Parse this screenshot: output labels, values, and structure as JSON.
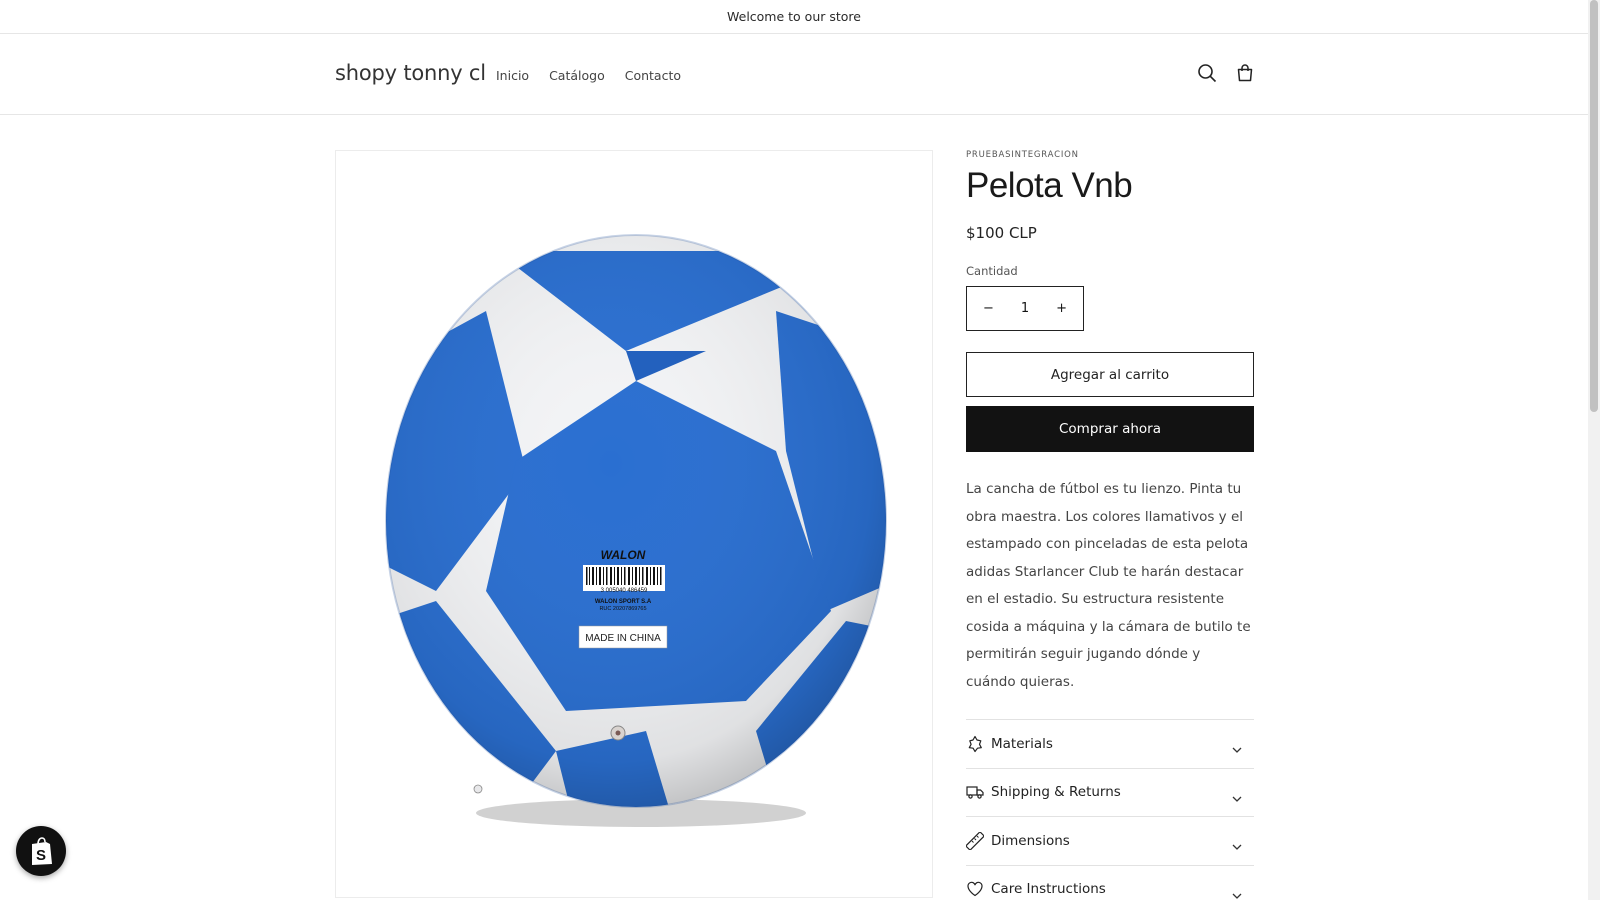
{
  "announcement": {
    "text": "Welcome to our store"
  },
  "header": {
    "logo": "shopy tonny cl",
    "nav": [
      "Inicio",
      "Catálogo",
      "Contacto"
    ],
    "icons": [
      "search-icon",
      "cart-icon"
    ]
  },
  "product": {
    "vendor": "PRUEBASINTEGRACION",
    "title": "Pelota Vnb",
    "price": "$100 CLP",
    "quantity_label": "Cantidad",
    "quantity_value": "1",
    "qty_minus": "−",
    "qty_plus": "+",
    "add_to_cart": "Agregar al carrito",
    "buy_now": "Comprar ahora",
    "description": "La cancha de fútbol es tu lienzo. Pinta tu obra maestra. Los colores llamativos y el estampado con pinceladas de esta pelota adidas Starlancer Club te harán destacar en el estadio. Su estructura resistente cosida a máquina y la cámara de butilo te permitirán seguir jugando dónde y cuándo quieras.",
    "image_labels": {
      "brand": "WALON",
      "barcode_number": "3 005040 486459",
      "company": "WALON SPORT S.A",
      "ruc": "RUC 20207869765",
      "origin": "MADE IN CHINA"
    }
  },
  "accordion": [
    {
      "label": "Materials",
      "icon": "puzzle-icon"
    },
    {
      "label": "Shipping & Returns",
      "icon": "truck-icon"
    },
    {
      "label": "Dimensions",
      "icon": "ruler-icon"
    },
    {
      "label": "Care Instructions",
      "icon": "heart-icon"
    }
  ],
  "colors": {
    "ball_blue": "#2a6fd1",
    "button_dark": "#121212"
  }
}
